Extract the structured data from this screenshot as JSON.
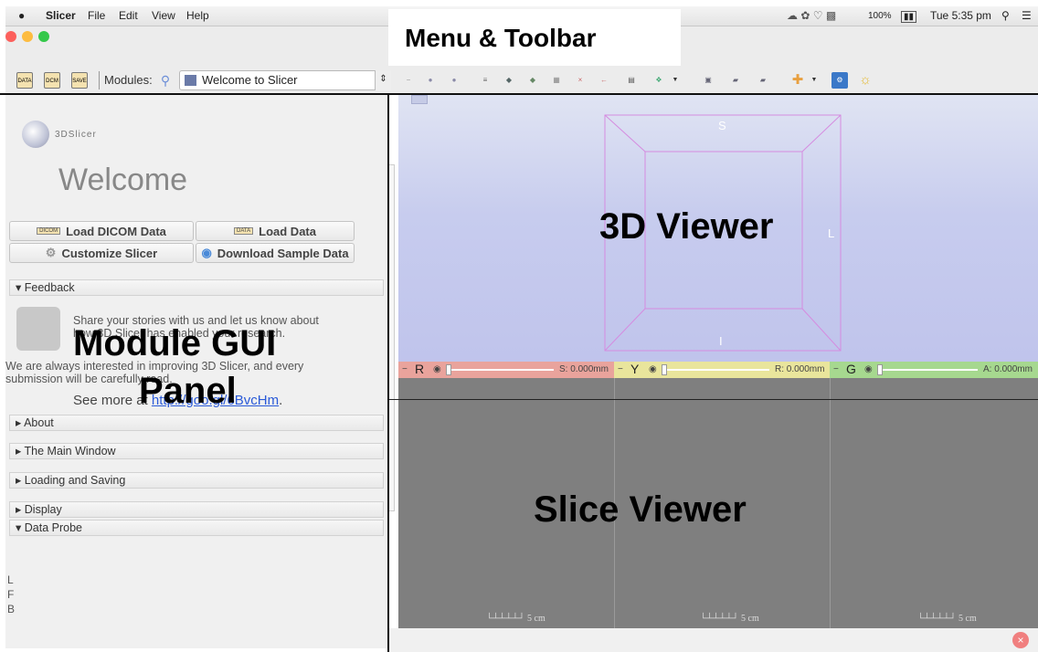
{
  "menubar": {
    "apple": "",
    "app_name": "Slicer",
    "items": [
      "File",
      "Edit",
      "View",
      "Help"
    ],
    "battery": "100%",
    "clock": "Tue 5:35 pm"
  },
  "toolbar": {
    "data_icon": "DATA",
    "dcm_icon": "DCM",
    "save_icon": "SAVE",
    "modules_label": "Modules:",
    "module_select": "Welcome to Slicer"
  },
  "annotations": {
    "toolbar": "Menu & Toolbar",
    "viewer_3d": "3D Viewer",
    "module_panel_1": "Module GUI",
    "module_panel_2": "Panel",
    "slice_viewer": "Slice Viewer"
  },
  "module_panel": {
    "logo_text": "3DSlicer",
    "welcome": "Welcome",
    "load_dicom": "Load DICOM Data",
    "load_data": "Load Data",
    "customize": "Customize Slicer",
    "download_sample": "Download Sample Data",
    "dicom_icon": "DICOM",
    "data_icon": "DATA",
    "feedback_header": "Feedback",
    "feedback_line1": "Share your stories with us and let us know about",
    "feedback_line2": "how 3D Slicer has enabled your research.",
    "feedback_line3": "We are always interested in improving 3D Slicer, and every",
    "feedback_line4": "submission will be carefully read.",
    "see_more_prefix": "See more at",
    "see_more_link": "http://goo.gl/6BvcHm",
    "see_more_suffix": ".",
    "sections": [
      "About",
      "The Main Window",
      "Loading and Saving",
      "Display"
    ],
    "data_probe_header": "Data Probe",
    "probe_labels": [
      "L",
      "F",
      "B"
    ]
  },
  "viewer_3d": {
    "top_label": "S",
    "bottom_label": "I",
    "right_label": "L"
  },
  "slice_views": [
    {
      "name": "R",
      "offset": "S: 0.000mm",
      "color": "#e9a39c"
    },
    {
      "name": "Y",
      "offset": "R: 0.000mm",
      "color": "#e9e59c"
    },
    {
      "name": "G",
      "offset": "A: 0.000mm",
      "color": "#a6d88f"
    }
  ],
  "scale_label": "5 cm"
}
